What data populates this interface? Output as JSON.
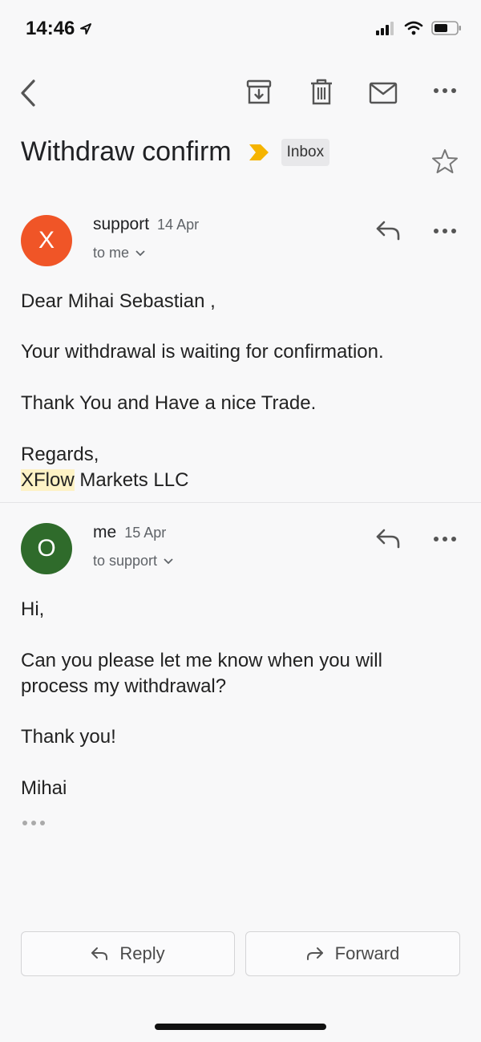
{
  "status": {
    "time": "14:46"
  },
  "email": {
    "subject": "Withdraw confirm",
    "label": "Inbox",
    "messages": [
      {
        "avatar_letter": "X",
        "avatar_color": "#f05527",
        "sender": "support",
        "date": "14 Apr",
        "recipients": "to me",
        "lines": [
          "Dear Mihai Sebastian ,",
          "Your withdrawal is waiting for confirmation.",
          "Thank You and Have a nice Trade.",
          "Regards,"
        ],
        "signature_highlight": "XFlow",
        "signature_rest": " Markets LLC"
      },
      {
        "avatar_letter": "O",
        "avatar_color": "#2f6b2b",
        "sender": "me",
        "date": "15 Apr",
        "recipients": "to support",
        "lines": [
          "Hi,",
          "Can you please let me know when you will",
          "process my withdrawal?",
          "Thank you!",
          "Mihai"
        ]
      }
    ]
  },
  "actions": {
    "reply": "Reply",
    "forward": "Forward"
  },
  "icons": {
    "back": "chevron-left-icon",
    "archive": "archive-icon",
    "delete": "trash-icon",
    "mark_unread": "mail-icon",
    "more": "more-horizontal-icon",
    "star": "star-icon",
    "reply": "reply-icon",
    "forward": "forward-icon"
  },
  "colors": {
    "label_arrow": "#f5b400"
  }
}
